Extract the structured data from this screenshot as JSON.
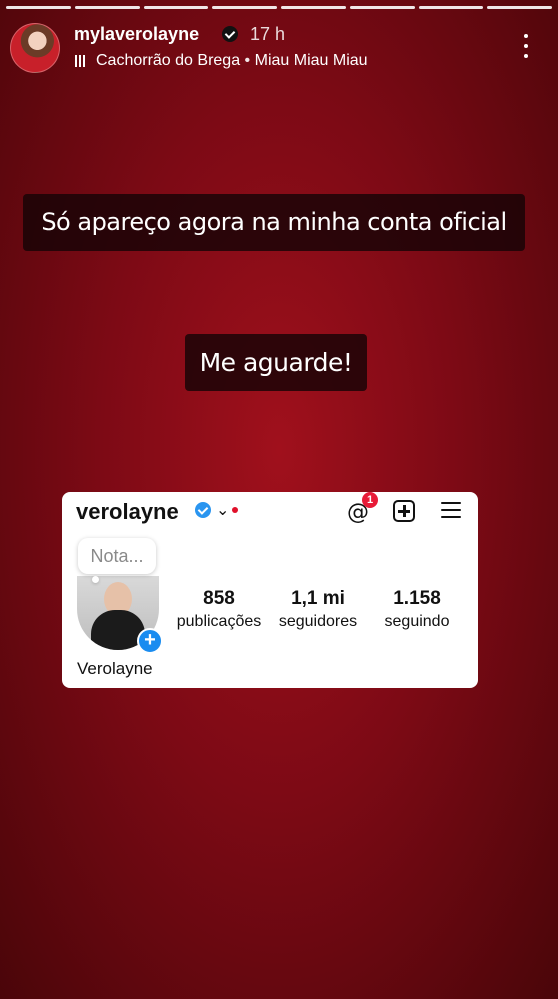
{
  "story": {
    "segments": 8,
    "username": "mylaverolayne",
    "time": "17 h",
    "music": {
      "title": "Cachorrão do Brega",
      "separator": "•",
      "artist": "Miau Miau Miau"
    },
    "more_icon": "more-vertical-icon"
  },
  "stickers": {
    "line1": "Só apareço agora na minha conta oficial",
    "line2": "Me aguarde!"
  },
  "profile_card": {
    "username": "verolayne",
    "threads_badge": "1",
    "note_placeholder": "Nota...",
    "display_name": "Verolayne",
    "stats": [
      {
        "value": "858",
        "label": "publicações"
      },
      {
        "value": "1,1 mi",
        "label": "seguidores"
      },
      {
        "value": "1.158",
        "label": "seguindo"
      }
    ]
  },
  "colors": {
    "background": "#8a0c17",
    "verified": "#2a95f0",
    "notification": "#e81b38"
  }
}
